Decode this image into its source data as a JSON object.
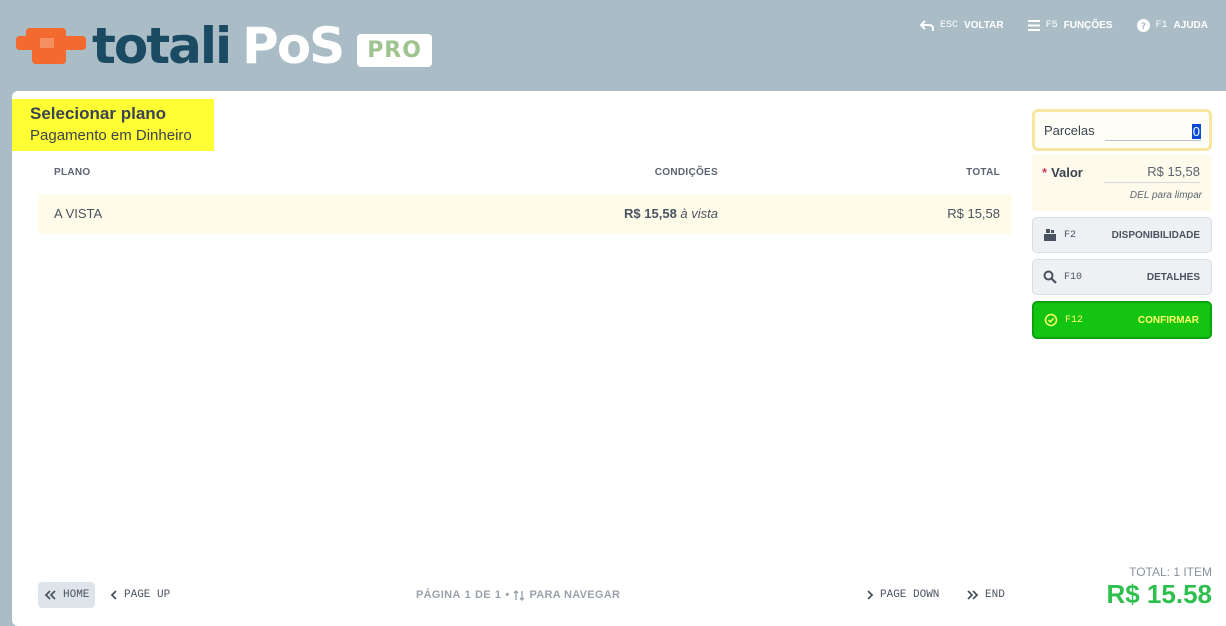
{
  "app": {
    "logo_word_1": "totali",
    "logo_word_2": "PoS",
    "badge": "PRO",
    "colors": {
      "logo_orange": "#f26a2e",
      "logo_dark": "#1b4a63",
      "confirm_green": "#13c413",
      "total_green": "#2fbf4f",
      "highlight": "#ffff33"
    }
  },
  "shortcuts": [
    {
      "icon": "back-arrow-icon",
      "key": "ESC",
      "label": "VOLTAR"
    },
    {
      "icon": "menu-icon",
      "key": "F5",
      "label": "FUNÇÕES"
    },
    {
      "icon": "help-icon",
      "key": "F1",
      "label": "AJUDA"
    }
  ],
  "heading": {
    "title": "Selecionar plano",
    "subtitle": "Pagamento em Dinheiro"
  },
  "table": {
    "columns": [
      "PLANO",
      "CONDIÇÕES",
      "TOTAL"
    ],
    "rows": [
      {
        "plan": "A VISTA",
        "cond_amount": "R$ 15,58",
        "cond_text": "à vista",
        "total": "R$ 15,58"
      }
    ]
  },
  "pager": {
    "home": "HOME",
    "page_up": "PAGE UP",
    "page_down": "PAGE DOWN",
    "end": "END",
    "info_prefix": "PÁGINA",
    "page": "1",
    "of": "DE",
    "pages": "1",
    "nav": "PARA NAVEGAR"
  },
  "side": {
    "parcelas_label": "Parcelas",
    "parcelas_value": "0",
    "valor_label": "Valor",
    "valor_value": "R$ 15,58",
    "valor_hint": "DEL para limpar",
    "buttons": [
      {
        "icon": "stock-icon",
        "key": "F2",
        "label": "DISPONIBILIDADE"
      },
      {
        "icon": "search-icon",
        "key": "F10",
        "label": "DETALHES"
      },
      {
        "icon": "check-circle-icon",
        "key": "F12",
        "label": "CONFIRMAR"
      }
    ]
  },
  "summary": {
    "count": "TOTAL: 1 ITEM",
    "amount": "R$ 15.58"
  }
}
